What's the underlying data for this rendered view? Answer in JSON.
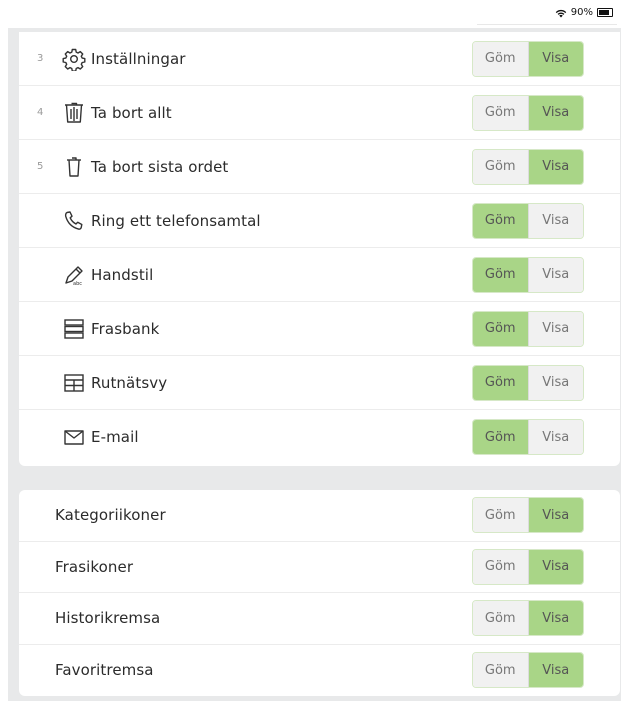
{
  "status_bar": {
    "battery_text": "90%",
    "battery_level": 0.9
  },
  "toggle_labels": {
    "hide": "Göm",
    "show": "Visa"
  },
  "tools": [
    {
      "number": "3",
      "icon": "gear-icon",
      "label": "Inställningar",
      "selected": "show"
    },
    {
      "number": "4",
      "icon": "trash-all-icon",
      "label": "Ta bort allt",
      "selected": "show"
    },
    {
      "number": "5",
      "icon": "trash-icon",
      "label": "Ta bort sista ordet",
      "selected": "show"
    },
    {
      "number": "",
      "icon": "phone-icon",
      "label": "Ring ett telefonsamtal",
      "selected": "hide"
    },
    {
      "number": "",
      "icon": "handwriting-icon",
      "label": "Handstil",
      "selected": "hide"
    },
    {
      "number": "",
      "icon": "phrasebank-icon",
      "label": "Frasbank",
      "selected": "hide"
    },
    {
      "number": "",
      "icon": "grid-view-icon",
      "label": "Rutnätsvy",
      "selected": "hide"
    },
    {
      "number": "",
      "icon": "email-icon",
      "label": "E-mail",
      "selected": "hide"
    }
  ],
  "display_options": [
    {
      "label": "Kategoriikoner",
      "selected": "show"
    },
    {
      "label": "Frasikoner",
      "selected": "show"
    },
    {
      "label": "Historikremsa",
      "selected": "show"
    },
    {
      "label": "Favoritremsa",
      "selected": "show"
    }
  ],
  "colors": {
    "active_segment": "#a9d587",
    "inactive_segment": "#f1f1f1",
    "backdrop": "#e8e9ea"
  }
}
